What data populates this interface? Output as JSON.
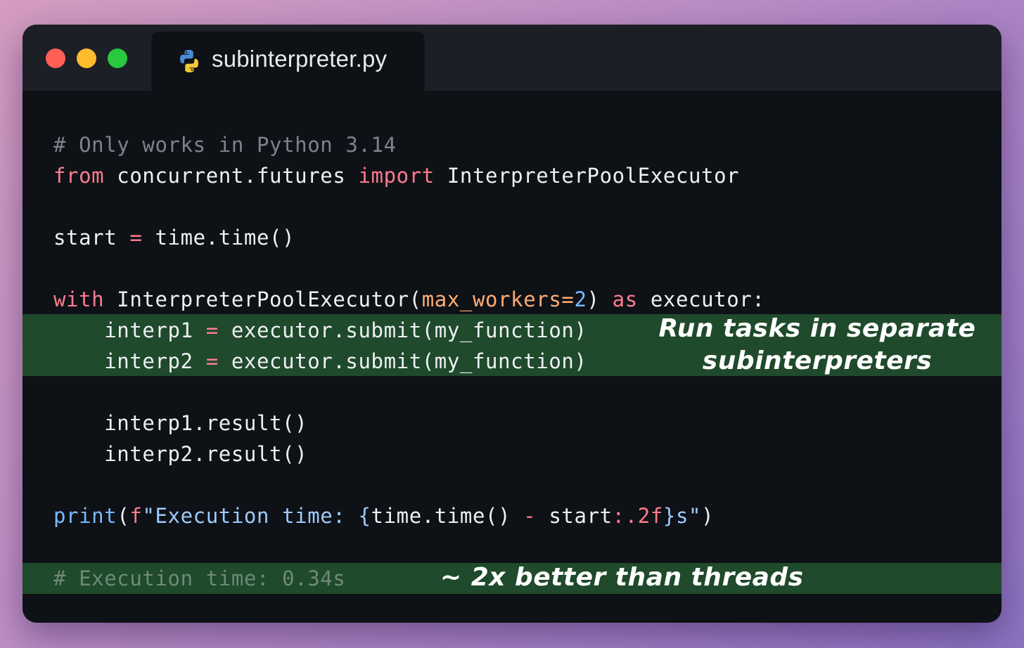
{
  "window": {
    "tab_title": "subinterpreter.py",
    "tab_icon": "python-icon"
  },
  "code": {
    "line1": {
      "comment": "# Only works in Python 3.14"
    },
    "line2": {
      "kw_from": "from",
      "module": " concurrent.futures ",
      "kw_import": "import",
      "name": " InterpreterPoolExecutor"
    },
    "line3": {
      "var": "start",
      "sp1": " ",
      "op": "=",
      "expr": " time.time()"
    },
    "line4": {
      "kw_with": "with",
      "call": " InterpreterPoolExecutor(",
      "param": "max_workers",
      "eq": "=",
      "num": "2",
      "close": ") ",
      "kw_as": "as",
      "target": " executor:"
    },
    "line5": {
      "indent": "    ",
      "var": "interp1",
      "sp": " ",
      "op": "=",
      "expr": " executor.submit(my_function)"
    },
    "line6": {
      "indent": "    ",
      "var": "interp2",
      "sp": " ",
      "op": "=",
      "expr": " executor.submit(my_function)"
    },
    "line7": {
      "text": "    interp1.result()"
    },
    "line8": {
      "text": "    interp2.result()"
    },
    "line9": {
      "fn": "print",
      "paren": "(",
      "fprefix": "f",
      "str1": "\"Execution time: ",
      "brace_open": "{",
      "expr": "time.time() ",
      "minus": "-",
      "var": " start",
      "fmt": ":.2f",
      "brace_close": "}",
      "str2": "s\"",
      "paren_close": ")"
    },
    "line10": {
      "comment": "# Execution time: 0.34s"
    }
  },
  "annotations": {
    "subinterpreters_line1": "Run tasks in separate",
    "subinterpreters_line2": "subinterpreters",
    "speedup": "~ 2x better than threads"
  },
  "colors": {
    "window_bg": "#0e1116",
    "titlebar_bg": "#1c1f26",
    "highlight_green": "#1f4a2b",
    "keyword": "#ff7b8e",
    "param": "#ffad73",
    "number": "#79b8ff",
    "comment": "#7d838d"
  }
}
